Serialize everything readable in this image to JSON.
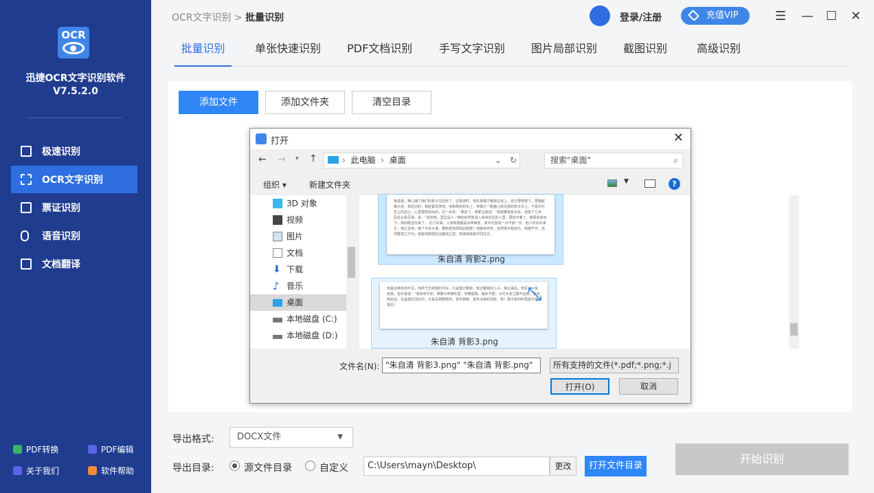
{
  "app": {
    "logo_text": "OCR",
    "name": "迅捷OCR文字识别软件",
    "version": "V7.5.2.0"
  },
  "sidebar": {
    "items": [
      {
        "label": "极速识别",
        "icon": "lightning-doc-icon"
      },
      {
        "label": "OCR文字识别",
        "icon": "scan-icon"
      },
      {
        "label": "票证识别",
        "icon": "ticket-icon"
      },
      {
        "label": "语音识别",
        "icon": "microphone-icon"
      },
      {
        "label": "文档翻译",
        "icon": "translate-icon"
      }
    ],
    "bottom": [
      {
        "label": "PDF转换",
        "color": "#3bb36a"
      },
      {
        "label": "PDF编辑",
        "color": "#5a63e6"
      },
      {
        "label": "关于我们",
        "color": "#5a63e6"
      },
      {
        "label": "软件帮助",
        "color": "#f08a3c"
      }
    ]
  },
  "header": {
    "crumb_parent": "OCR文字识别",
    "crumb_sep": ">",
    "crumb_current": "批量识别",
    "login": "登录/注册",
    "vip": "充值VIP",
    "menu_glyph": "☰",
    "min_glyph": "—",
    "max_glyph": "☐",
    "close_glyph": "✕"
  },
  "tabs": [
    "批量识别",
    "单张快速识别",
    "PDF文档识别",
    "手写文字识别",
    "图片局部识别",
    "截图识别",
    "高级识别"
  ],
  "actions": {
    "add_file": "添加文件",
    "add_folder": "添加文件夹",
    "clear": "清空目录"
  },
  "dialog": {
    "title": "打开",
    "path": [
      "此电脑",
      "桌面"
    ],
    "search_placeholder": "搜索\"桌面\"",
    "organize": "组织 ▾",
    "new_folder": "新建文件夹",
    "tree": [
      "3D 对象",
      "视频",
      "图片",
      "文档",
      "下载",
      "音乐",
      "桌面",
      "本地磁盘 (C:)",
      "本地磁盘 (D:)"
    ],
    "files": [
      {
        "name": "朱自清 背影2.png",
        "text": "我说道，唯心拥了我们的帆子往回走了。过铁道时，他先将橘子散放在地上，自己慢慢爬下，再抱起橘子走。到这边时，我赶紧去搀他。他和我走到车上，将橘子一股脑儿放在我的皮大衣上。于是扑扑衣上的泥土，心里很轻松似的。过一会说：“我走了，到那边来信！”我望着他走出去。他走了几步，回过头看见我，说：“进去吧，里边没人。”等他的背影混入来来往往的人里，再找不着了，我便进来坐下，我的眼泪又来了。  近几年来，父亲和我都是东奔西走，家中光景是一日不如一日。他少年出外谋生，独立支持，做了许多大事。哪知老境却如此颓唐！他触目伤怀，自然情不能自已。情郁于中，自然要发之于外；家庭琐屑便往往触他之怒。他待我渐渐不同往日。"
      },
      {
        "name": "朱自清 背影3.png",
        "text": "但最近两年的不见，他终于忘却我的不好，只是惦记着我，惦记着我的儿子。我北来后，他写了一信给我，信中说道：“我身体平安，惟膀子疼痛利害，举箸提笔，诸多不便，大约大去之期不远矣。”我读到此处，在晶莹的泪光中，又看见那肥胖的、青布棉袍、黑布马褂的背影。唉！我不知何时再能与他相见！"
      }
    ],
    "filename_label": "文件名(N):",
    "filename_value": "\"朱自清 背影3.png\" \"朱自清 背影.png\"",
    "filetype": "所有支持的文件(*.pdf;*.png;*.j",
    "open": "打开(O)",
    "cancel": "取消"
  },
  "export": {
    "format_label": "导出格式:",
    "format_value": "DOCX文件",
    "dir_label": "导出目录:",
    "opt_source": "源文件目录",
    "opt_custom": "自定义",
    "path": "C:\\Users\\mayn\\Desktop\\",
    "change": "更改",
    "open_dir": "打开文件目录",
    "start": "开始识别"
  },
  "colors": {
    "sidebar": "#1f3c8f",
    "accent": "#2f86f6"
  }
}
